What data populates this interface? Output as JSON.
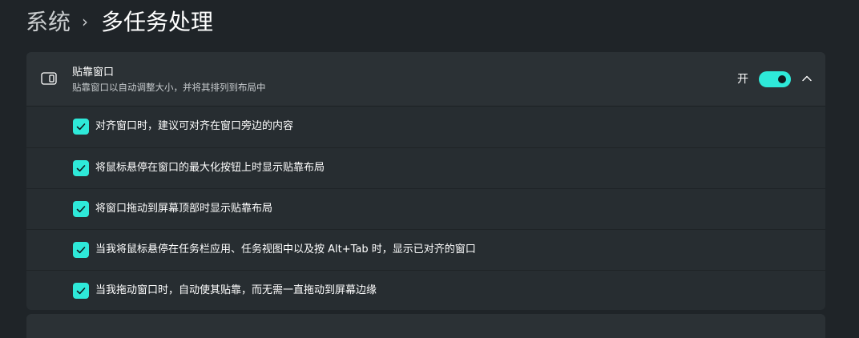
{
  "breadcrumb": {
    "parent": "系统",
    "separator": "›",
    "current": "多任务处理"
  },
  "snap": {
    "icon": "snap-window-icon",
    "title": "贴靠窗口",
    "description": "贴靠窗口以自动调整大小，并将其排列到布局中",
    "toggle_label": "开",
    "toggle_on": true,
    "expanded": true,
    "accent_color": "#2ee9d9",
    "options": [
      {
        "label": "对齐窗口时，建议可对齐在窗口旁边的内容",
        "checked": true
      },
      {
        "label": "将鼠标悬停在窗口的最大化按钮上时显示贴靠布局",
        "checked": true
      },
      {
        "label": "将窗口拖动到屏幕顶部时显示贴靠布局",
        "checked": true
      },
      {
        "label": "当我将鼠标悬停在任务栏应用、任务视图中以及按 Alt+Tab 时，显示已对齐的窗口",
        "checked": true
      },
      {
        "label": "当我拖动窗口时，自动使其贴靠，而无需一直拖动到屏幕边缘",
        "checked": true
      }
    ]
  }
}
